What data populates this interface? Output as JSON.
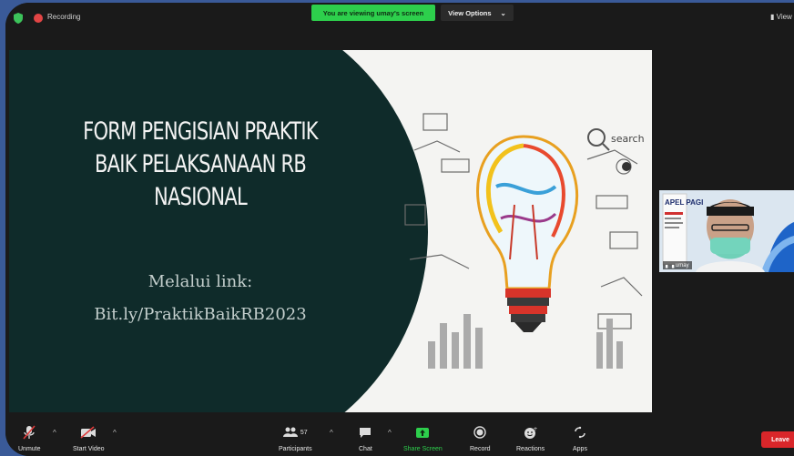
{
  "topbar": {
    "recording_label": "Recording",
    "viewing_label": "You are viewing umay's screen",
    "view_options_label": "View Options",
    "view_right_label": "View"
  },
  "slide": {
    "title_lines": [
      "FORM PENGISIAN PRAKTIK",
      "BAIK PELAKSANAAN RB",
      "NASIONAL"
    ],
    "subtitle": "Melalui link:",
    "link": "Bit.ly/PraktikBaikRB2023",
    "art_text": "search"
  },
  "video_tile": {
    "sign_text": "APEL PAGI",
    "name": "umay"
  },
  "toolbar": {
    "unmute_label": "Unmute",
    "start_video_label": "Start Video",
    "participants_label": "Participants",
    "participants_count": "57",
    "chat_label": "Chat",
    "share_screen_label": "Share Screen",
    "record_label": "Record",
    "reactions_label": "Reactions",
    "apps_label": "Apps",
    "leave_label": "Leave"
  },
  "colors": {
    "accent_green": "#2dcf4c",
    "leave_red": "#d9262a",
    "slide_dark": "#0f2b2a",
    "outer_blue": "#3a5a98"
  }
}
